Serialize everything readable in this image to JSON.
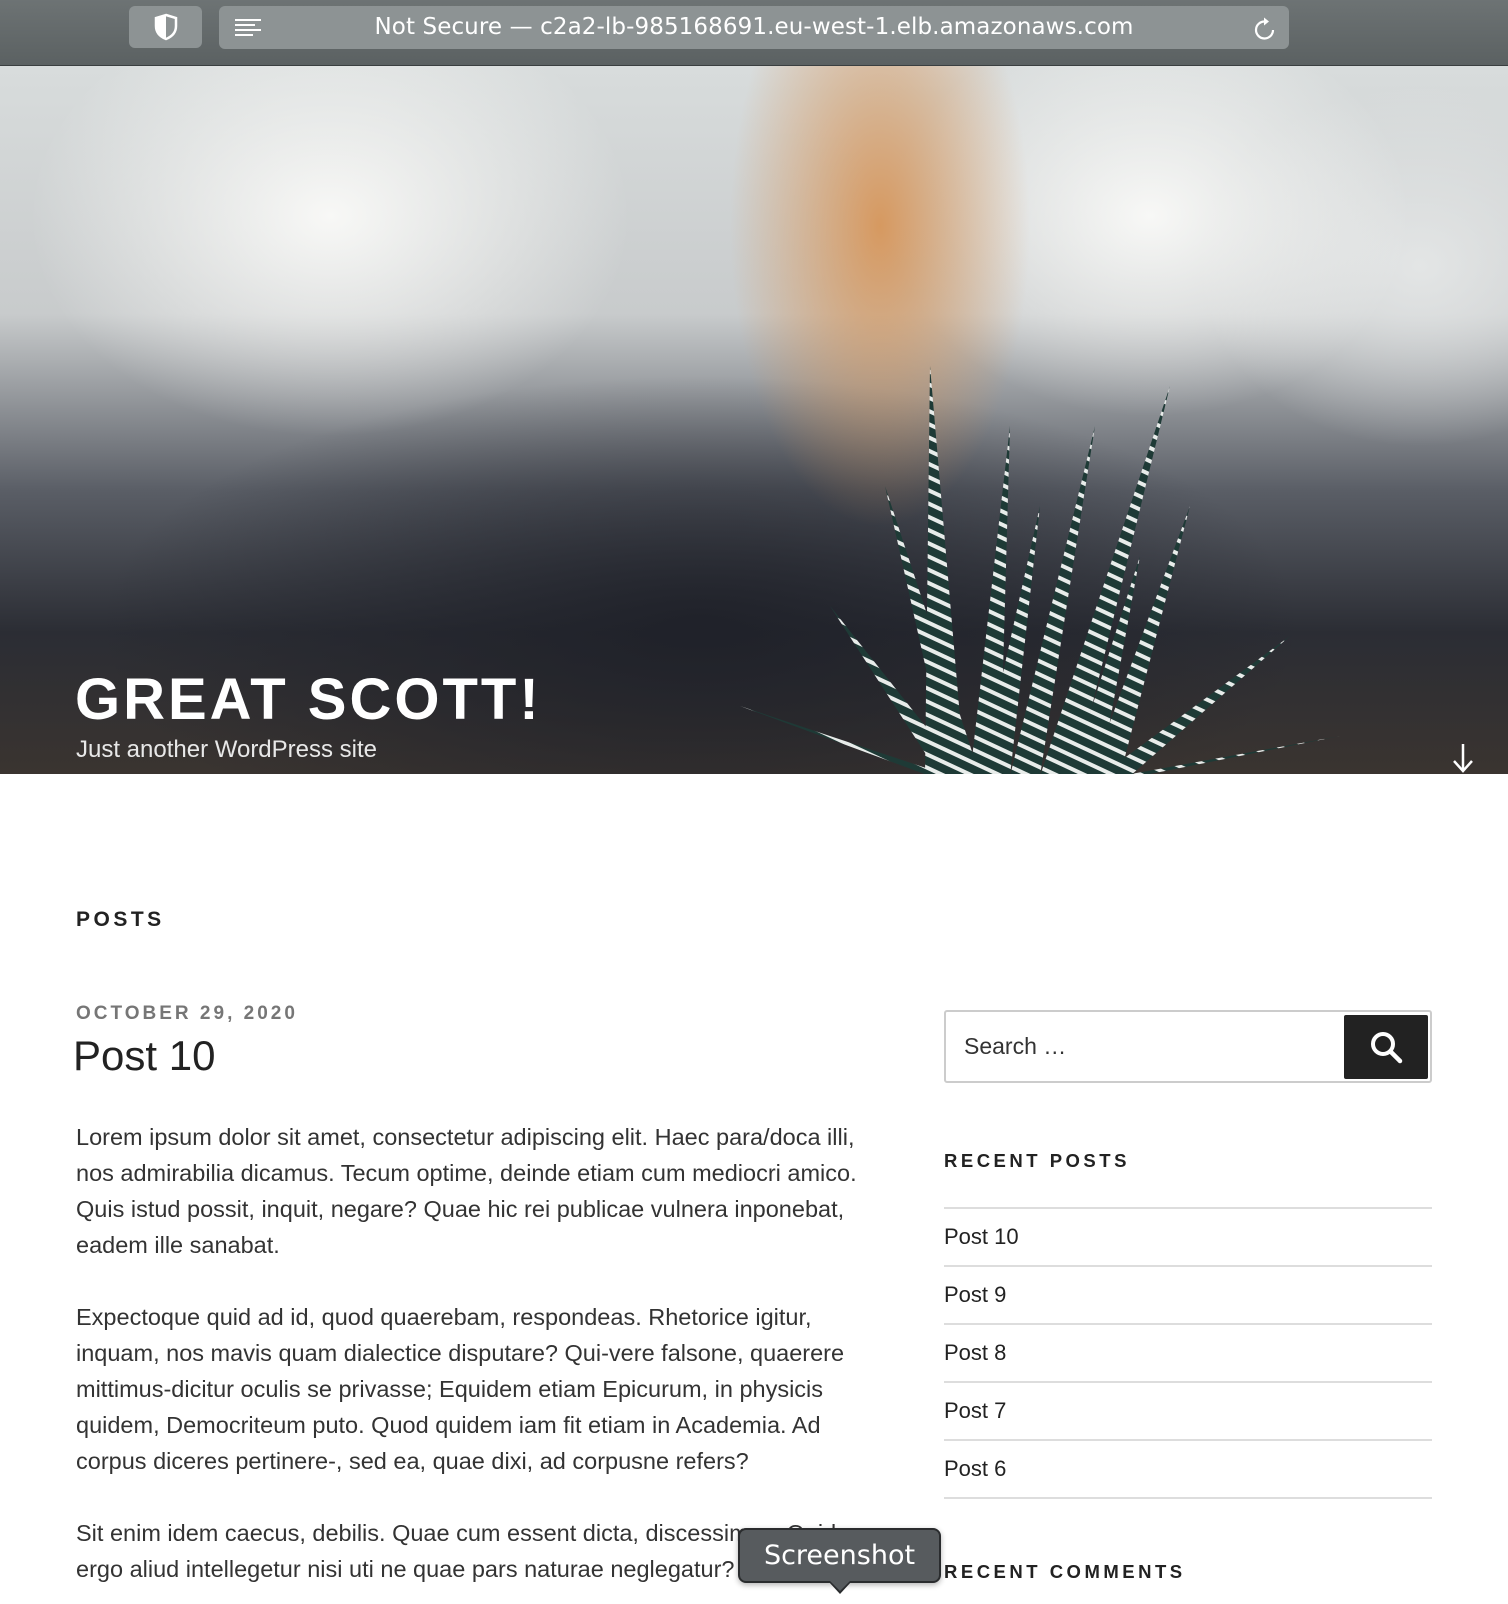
{
  "browser": {
    "url_text": "Not Secure — c2a2-lb-985168691.eu-west-1.elb.amazonaws.com"
  },
  "site": {
    "title": "GREAT SCOTT!",
    "tagline": "Just another WordPress site"
  },
  "main": {
    "section_heading": "POSTS",
    "post": {
      "date": "OCTOBER 29, 2020",
      "title": "Post 10",
      "paragraphs": [
        "Lorem ipsum dolor sit amet, consectetur adipiscing elit. Haec para/doca illi, nos admirabilia dicamus. Tecum optime, deinde etiam cum mediocri amico. Quis istud possit, inquit, negare? Quae hic rei publicae vulnera inponebat, eadem ille sanabat.",
        "Expectoque quid ad id, quod quaerebam, respondeas. Rhetorice igitur, inquam, nos mavis quam dialectice disputare? Qui-vere falsone, quaerere mittimus-dicitur oculis se privasse; Equidem etiam Epicurum, in physicis quidem, Democriteum puto. Quod quidem iam fit etiam in Academia. Ad corpus diceres pertinere-, sed ea, quae dixi, ad corpusne refers?",
        "Sit enim idem caecus, debilis. Quae cum essent dicta, discessimus. Quid ergo aliud intellegetur nisi uti ne quae pars naturae neglegatur?"
      ]
    }
  },
  "sidebar": {
    "search": {
      "placeholder": "Search …"
    },
    "recent_posts_title": "RECENT POSTS",
    "recent_posts": [
      "Post 10",
      "Post 9",
      "Post 8",
      "Post 7",
      "Post 6"
    ],
    "recent_comments_title": "RECENT COMMENTS"
  },
  "overlay": {
    "tooltip_label": "Screenshot"
  },
  "icons": {
    "shield": "shield-icon",
    "reader": "reader-mode-icon",
    "reload": "reload-icon",
    "scroll_down": "arrow-down-icon",
    "search": "search-icon"
  }
}
